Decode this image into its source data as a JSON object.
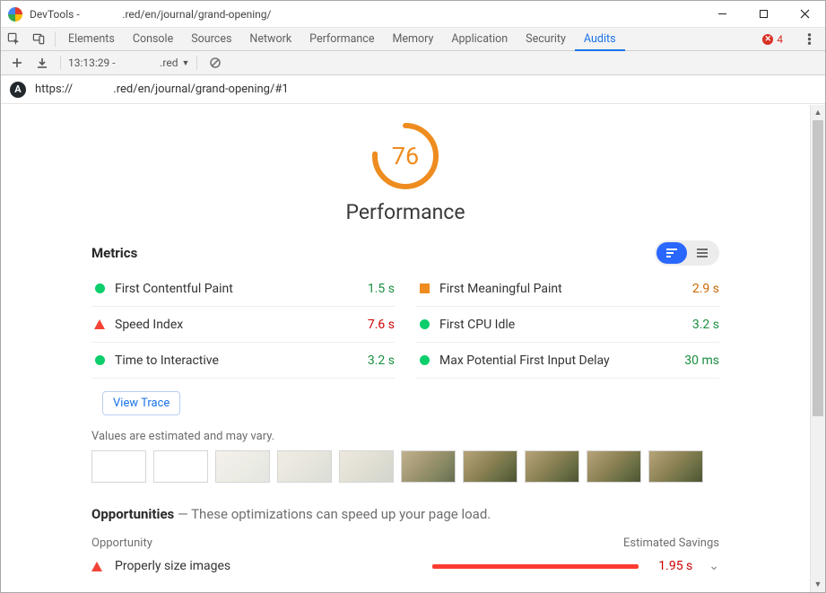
{
  "window": {
    "title_prefix": "DevTools - ",
    "title_path": ".red/en/journal/grand-opening/"
  },
  "tabs": {
    "items": [
      "Elements",
      "Console",
      "Sources",
      "Network",
      "Performance",
      "Memory",
      "Application",
      "Security",
      "Audits"
    ],
    "active": "Audits",
    "error_count": "4"
  },
  "audits_toolbar": {
    "run_label_time": "13:13:29 - ",
    "run_label_host": ".red"
  },
  "url_bar": {
    "prefix": "https://",
    "path": ".red/en/journal/grand-opening/#1"
  },
  "gauge": {
    "score": "76",
    "label": "Performance"
  },
  "metrics": {
    "title": "Metrics",
    "left": [
      {
        "icon": "green",
        "name": "First Contentful Paint",
        "value": "1.5 s",
        "vclass": "val-green"
      },
      {
        "icon": "tri",
        "name": "Speed Index",
        "value": "7.6 s",
        "vclass": "val-red"
      },
      {
        "icon": "green",
        "name": "Time to Interactive",
        "value": "3.2 s",
        "vclass": "val-green"
      }
    ],
    "right": [
      {
        "icon": "sq",
        "name": "First Meaningful Paint",
        "value": "2.9 s",
        "vclass": "val-orange"
      },
      {
        "icon": "green",
        "name": "First CPU Idle",
        "value": "3.2 s",
        "vclass": "val-green"
      },
      {
        "icon": "green",
        "name": "Max Potential First Input Delay",
        "value": "30 ms",
        "vclass": "val-green"
      }
    ],
    "view_trace": "View Trace",
    "note": "Values are estimated and may vary."
  },
  "opportunities": {
    "title": "Opportunities",
    "subtitle": " — These optimizations can speed up your page load.",
    "col_left": "Opportunity",
    "col_right": "Estimated Savings",
    "items": [
      {
        "name": "Properly size images",
        "value": "1.95 s"
      }
    ]
  },
  "chart_data": {
    "type": "table",
    "title": "Lighthouse Performance Metrics",
    "score": 76,
    "metrics": [
      {
        "name": "First Contentful Paint",
        "value": 1.5,
        "unit": "s",
        "status": "pass"
      },
      {
        "name": "Speed Index",
        "value": 7.6,
        "unit": "s",
        "status": "fail"
      },
      {
        "name": "Time to Interactive",
        "value": 3.2,
        "unit": "s",
        "status": "pass"
      },
      {
        "name": "First Meaningful Paint",
        "value": 2.9,
        "unit": "s",
        "status": "average"
      },
      {
        "name": "First CPU Idle",
        "value": 3.2,
        "unit": "s",
        "status": "pass"
      },
      {
        "name": "Max Potential First Input Delay",
        "value": 30,
        "unit": "ms",
        "status": "pass"
      }
    ],
    "opportunities": [
      {
        "name": "Properly size images",
        "savings_s": 1.95
      }
    ]
  }
}
